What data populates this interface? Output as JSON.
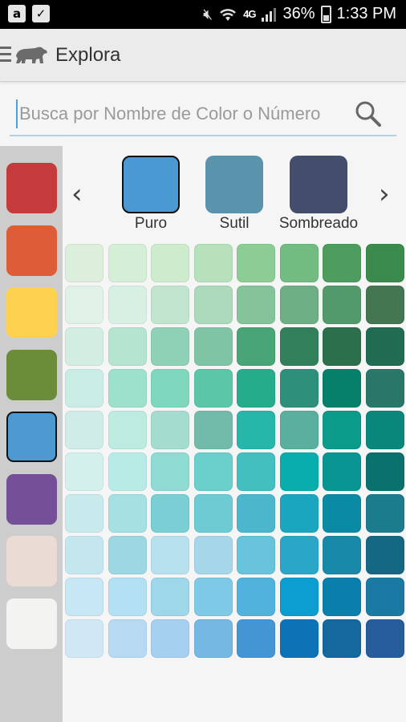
{
  "status_bar": {
    "time": "1:33 PM",
    "battery": "36%",
    "network": "4G",
    "left_icons": [
      "amazon-icon",
      "download-icon"
    ]
  },
  "app_bar": {
    "title": "Explora",
    "menu_icon": "hamburger-icon",
    "logo_icon": "bear-icon"
  },
  "search": {
    "placeholder": "Busca por Nombre de Color o Número",
    "value": ""
  },
  "families": [
    {
      "name": "red",
      "color": "#c53b3c",
      "selected": false
    },
    {
      "name": "orange",
      "color": "#de5c38",
      "selected": false
    },
    {
      "name": "yellow",
      "color": "#fed24f",
      "selected": false
    },
    {
      "name": "green",
      "color": "#6b8c39",
      "selected": false
    },
    {
      "name": "blue",
      "color": "#4d9ad3",
      "selected": true
    },
    {
      "name": "purple",
      "color": "#735097",
      "selected": false
    },
    {
      "name": "pink",
      "color": "#eadbd5",
      "selected": false
    },
    {
      "name": "white",
      "color": "#f3f4f2",
      "selected": false
    }
  ],
  "shades": [
    {
      "label": "Puro",
      "color": "#4a99d2",
      "selected": true
    },
    {
      "label": "Sutil",
      "color": "#5a93ac",
      "selected": false
    },
    {
      "label": "Sombreado",
      "color": "#434e6c",
      "selected": false
    }
  ],
  "palette": [
    [
      "#dcefdc",
      "#d5efd6",
      "#cdebcd",
      "#b6e1bb",
      "#8ccd95",
      "#72bc81",
      "#4e9c5e",
      "#3c8b4e"
    ],
    [
      "#e0f1e6",
      "#d8f0e1",
      "#c0e4cd",
      "#acd9ba",
      "#85c49a",
      "#6dae85",
      "#529a6b",
      "#447651"
    ],
    [
      "#d2ede2",
      "#b5e4d1",
      "#8fd1b6",
      "#7fc5a5",
      "#48a577",
      "#327f5b",
      "#2b6f4c",
      "#216b53"
    ],
    [
      "#c9ede4",
      "#9de0cc",
      "#7fd8be",
      "#5cc7a8",
      "#25ad8b",
      "#2e8f7b",
      "#06806a",
      "#287769"
    ],
    [
      "#d0ece8",
      "#bdebe0",
      "#a5dcd0",
      "#72bbab",
      "#27b6aa",
      "#5aaf9e",
      "#0b9b8b",
      "#08877a"
    ],
    [
      "#d4f0ec",
      "#b8ebe6",
      "#8edbd4",
      "#6bd0cc",
      "#43bfc0",
      "#08aeab",
      "#099693",
      "#0a716f"
    ],
    [
      "#c9eaec",
      "#a7e0e2",
      "#79cfd3",
      "#6ccbd3",
      "#4cb6cc",
      "#1ba6c0",
      "#0a8aa4",
      "#1b7c8e"
    ],
    [
      "#c4e6ef",
      "#9ed7e4",
      "#b8e1ef",
      "#a5d7e9",
      "#66c3da",
      "#2aa6c7",
      "#1889a9",
      "#156883"
    ],
    [
      "#c6e7f3",
      "#b3e0f2",
      "#9ed6ea",
      "#7ec9e5",
      "#51b3db",
      "#0c9ed0",
      "#0a7fac",
      "#1a7aa4"
    ],
    [
      "#d0e8f6",
      "#b7daf2",
      "#a5d0f0",
      "#74b8e3",
      "#4395d3",
      "#0d72b6",
      "#14689e",
      "#265d9d"
    ]
  ]
}
